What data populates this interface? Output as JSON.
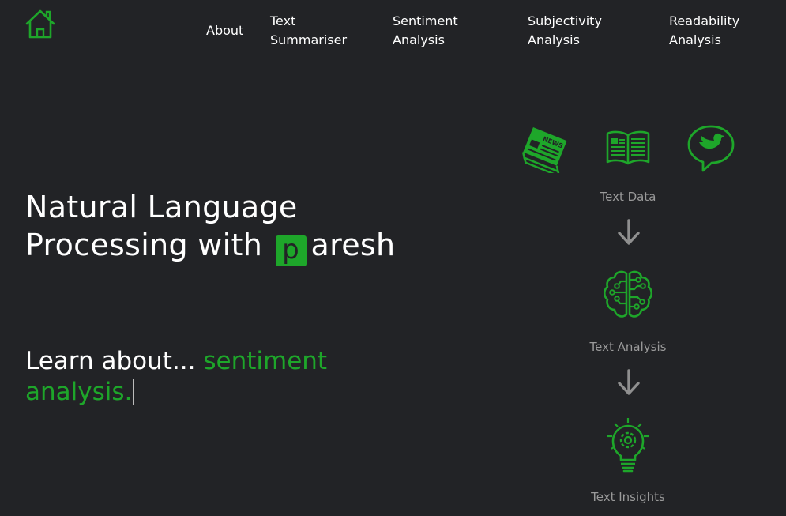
{
  "nav": {
    "home_icon": "home-icon",
    "items": [
      {
        "label": "About"
      },
      {
        "label": "Text\nSummariser"
      },
      {
        "label": "Sentiment\nAnalysis"
      },
      {
        "label": "Subjectivity\nAnalysis"
      },
      {
        "label": "Readability\nAnalysis"
      }
    ]
  },
  "hero": {
    "title_line1": "Natural Language",
    "title_line2_prefix": "Processing with",
    "logo_letter": "p",
    "title_line2_suffix": "aresh",
    "learn_prefix": "Learn about... ",
    "learn_typed": "sentiment analysis."
  },
  "flow": {
    "stage1_label": "Text Data",
    "stage2_label": "Text Analysis",
    "stage3_label": "Text Insights",
    "newspaper_text": "NEWS",
    "icons": [
      "newspaper-icon",
      "open-book-icon",
      "bird-speech-bubble-icon",
      "brain-circuit-icon",
      "lightbulb-gear-icon",
      "down-arrow-icon"
    ]
  },
  "colors": {
    "background": "#222326",
    "accent": "#1ea62a",
    "muted_text": "#9a9a9a",
    "arrow": "#8f8f8f"
  }
}
